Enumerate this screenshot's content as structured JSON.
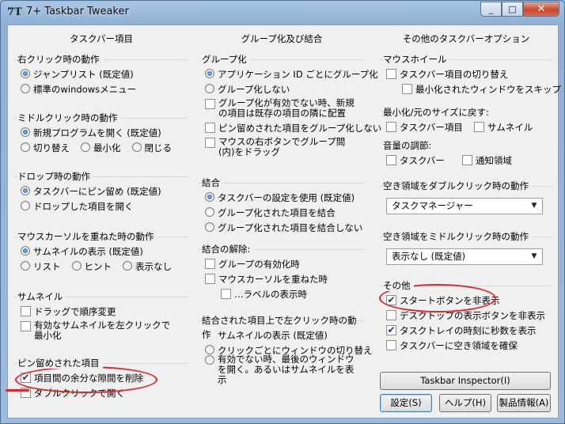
{
  "window": {
    "title": "7+ Taskbar Tweaker",
    "icon_text": "7T"
  },
  "caption": {
    "minimize": "_",
    "maximize": "□",
    "close": "✕"
  },
  "col1": {
    "header": "タスクバー項目",
    "rclick": {
      "title": "右クリック時の動作",
      "opt1": "ジャンプリスト (既定値)",
      "opt2": "標準のwindowsメニュー"
    },
    "mclick": {
      "title": "ミドルクリック時の動作",
      "opt1": "新規プログラムを開く (既定値)",
      "opt2": "切り替え",
      "opt3": "最小化",
      "opt4": "閉じる"
    },
    "drop": {
      "title": "ドロップ時の動作",
      "opt1": "タスクバーにピン留め (既定値)",
      "opt2": "ドロップした項目を開く"
    },
    "hover": {
      "title": "マウスカーソルを重ねた時の動作",
      "opt1": "サムネイルの表示 (既定値)",
      "opt2": "リスト",
      "opt3": "ヒント",
      "opt4": "表示なし"
    },
    "thumb": {
      "title": "サムネイル",
      "chk1": "ドラッグで順序変更",
      "chk2": "有効なサムネイルを左クリックで最小化"
    },
    "pinned": {
      "title": "ピン留めされた項目",
      "chk1": "項目間の余分な隙間を削除",
      "chk2": "ダブルクリックで開く"
    }
  },
  "col2": {
    "header": "グループ化及び結合",
    "grouping": {
      "title": "グループ化",
      "opt1": "アプリケーション ID ごとにグループ化",
      "opt2": "グループ化しない",
      "chk1": "グループ化が有効でない時、新規の項目は既存の項目の隣に配置",
      "chk2": "ピン留めされた項目をグループ化しない",
      "chk3": "マウスの右ボタンでグループ間(内)をドラッグ"
    },
    "combine": {
      "title": "結合",
      "opt1": "タスクバーの設定を使用 (既定値)",
      "opt2": "グループ化された項目を結合",
      "opt3": "グループ化された項目を結合しない"
    },
    "uncombine": {
      "title": "結合の解除:",
      "chk1": "グループの有効化時",
      "chk2": "マウスカーソルを重ねた時",
      "chk3": "…ラベルの表示時"
    },
    "leftclick": {
      "title": "結合された項目上で左クリック時の動作",
      "opt1": "サムネイルの表示 (既定値)",
      "opt2": "クリックごとにウィンドウの切り替え",
      "opt3": "有効でない時、最後のウィンドウを開く。あるいはサムネイルを表示"
    }
  },
  "col3": {
    "header": "その他のタスクバーオプション",
    "wheel": {
      "title": "マウスホイール",
      "chk1": "タスクバー項目の切り替え",
      "chk2": "最小化されたウィンドウをスキップ"
    },
    "minmax": {
      "title": "最小化/元のサイズに戻す:",
      "chk1": "タスクバー項目",
      "chk2": "サムネイル"
    },
    "volume": {
      "title": "音量の調節:",
      "chk1": "タスクバー",
      "chk2": "通知領域"
    },
    "dblclick": {
      "title": "空き領域をダブルクリック時の動作",
      "value": "タスクマネージャー"
    },
    "midclick": {
      "title": "空き領域をミドルクリック時の動作",
      "value": "表示なし (既定値)"
    },
    "other": {
      "title": "その他",
      "chk1": "スタートボタンを非表示",
      "chk2": "デスクトップの表示ボタンを非表示",
      "chk3": "タスクトレイの時刻に秒数を表示",
      "chk4": "タスクバーに空き領域を確保"
    },
    "inspector": "Taskbar Inspector(I)",
    "settings": "設定(S)",
    "help": "ヘルプ(H)",
    "about": "製品情報(A)"
  },
  "check_glyph": "✔",
  "arrow_glyph": "▼"
}
